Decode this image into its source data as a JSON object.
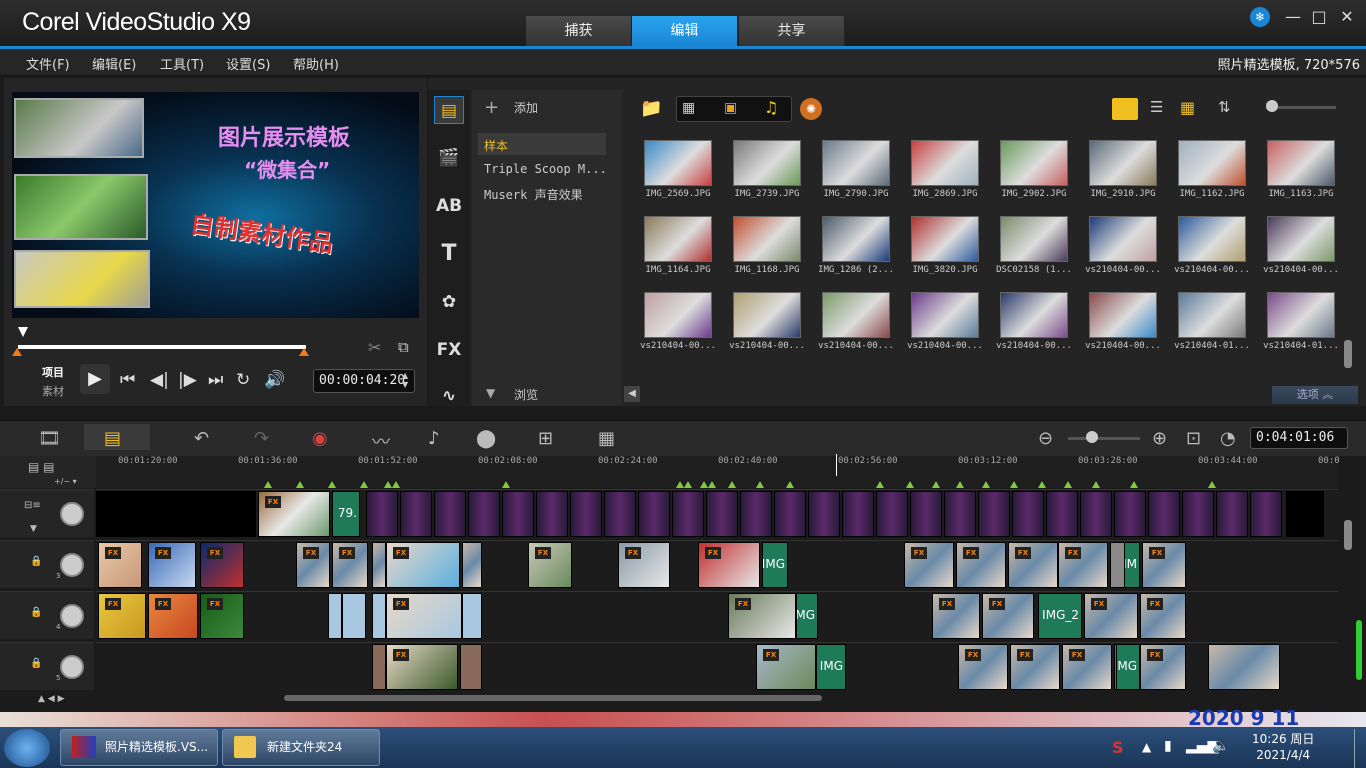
{
  "app": {
    "title": "Corel VideoStudio X9"
  },
  "main_tabs": [
    {
      "label": "捕获"
    },
    {
      "label": "编辑"
    },
    {
      "label": "共享"
    }
  ],
  "menus": [
    "文件(F)",
    "编辑(E)",
    "工具(T)",
    "设置(S)",
    "帮助(H)"
  ],
  "project_info": "照片精选模板, 720*576",
  "preview": {
    "title_line1": "图片展示模板",
    "title_line2": "“微集合”",
    "title_line3": "自制素材作品",
    "mode_project": "项目",
    "mode_clip": "素材",
    "timecode": "00:00:04:20"
  },
  "library": {
    "add_label": "添加",
    "browse_label": "浏览",
    "options_label": "选项",
    "folders": [
      "样本",
      "Triple Scoop M...",
      "Muserk 声音效果"
    ],
    "thumbnails": [
      "IMG_2569.JPG",
      "IMG_2739.JPG",
      "IMG_2790.JPG",
      "IMG_2869.JPG",
      "IMG_2902.JPG",
      "IMG_2910.JPG",
      "IMG_1162.JPG",
      "IMG_1163.JPG",
      "IMG_1164.JPG",
      "IMG_1168.JPG",
      "IMG_1286 (2...",
      "IMG_3820.JPG",
      "DSC02158 (1...",
      "vs210404-00...",
      "vs210404-00...",
      "vs210404-00...",
      "vs210404-00...",
      "vs210404-00...",
      "vs210404-00...",
      "vs210404-00...",
      "vs210404-00...",
      "vs210404-00...",
      "vs210404-01...",
      "vs210404-01..."
    ]
  },
  "timeline": {
    "timecode": "0:04:01:06",
    "ruler": [
      "00:01:20:00",
      "00:01:36:00",
      "00:01:52:00",
      "00:02:08:00",
      "00:02:24:00",
      "00:02:40:00",
      "00:02:56:00",
      "00:03:12:00",
      "00:03:28:00",
      "00:03:44:00",
      "00:0"
    ],
    "track_numbers": [
      "3",
      "4",
      "5"
    ],
    "clip_labels": {
      "main": "79.",
      "a": "IMG",
      "b": "IMG_2",
      "c": "IMG",
      "d": "IMG",
      "e": "IMG",
      "f": "IM",
      "g": "IMG"
    },
    "fx_label": "FX"
  },
  "taskbar": {
    "items": [
      {
        "label": "照片精选模板.VS..."
      },
      {
        "label": "新建文件夹24"
      }
    ],
    "time": "10:26 周日",
    "date": "2021/4/4",
    "bg_date": "2020 9 11"
  }
}
